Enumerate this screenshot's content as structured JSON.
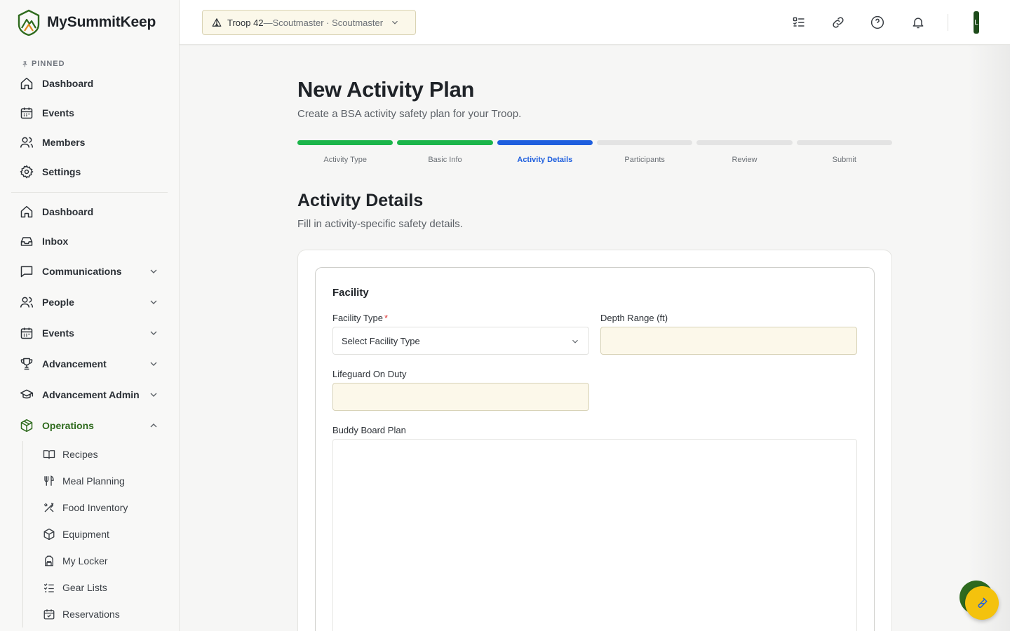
{
  "brand": {
    "name": "MySummitKeep"
  },
  "sidebar": {
    "pinned_label": "PINNED",
    "pinned": [
      {
        "label": "Dashboard",
        "icon": "home-icon"
      },
      {
        "label": "Events",
        "icon": "calendar-icon"
      },
      {
        "label": "Members",
        "icon": "users-icon"
      },
      {
        "label": "Settings",
        "icon": "gear-icon"
      }
    ],
    "main": [
      {
        "label": "Dashboard",
        "icon": "home-icon"
      },
      {
        "label": "Inbox",
        "icon": "inbox-icon"
      },
      {
        "label": "Communications",
        "icon": "message-icon",
        "expandable": true
      },
      {
        "label": "People",
        "icon": "users-icon",
        "expandable": true
      },
      {
        "label": "Events",
        "icon": "calendar-icon",
        "expandable": true
      },
      {
        "label": "Advancement",
        "icon": "trophy-icon",
        "expandable": true
      },
      {
        "label": "Advancement Admin",
        "icon": "graduation-cap-icon",
        "expandable": true
      },
      {
        "label": "Operations",
        "icon": "box-icon",
        "expandable": true,
        "expanded": true,
        "active": true
      }
    ],
    "operations_sub": [
      {
        "label": "Recipes",
        "icon": "book-icon"
      },
      {
        "label": "Meal Planning",
        "icon": "utensils-icon"
      },
      {
        "label": "Food Inventory",
        "icon": "utensils-crossed-icon"
      },
      {
        "label": "Equipment",
        "icon": "package-icon"
      },
      {
        "label": "My Locker",
        "icon": "backpack-icon"
      },
      {
        "label": "Gear Lists",
        "icon": "checklist-icon"
      },
      {
        "label": "Reservations",
        "icon": "calendar-check-icon"
      }
    ]
  },
  "topbar": {
    "troop_name": "Troop 42",
    "troop_separator": " — ",
    "troop_role": "Scoutmaster · Scoutmaster",
    "icons": [
      "checklist-icon",
      "link-icon",
      "help-icon",
      "bell-icon"
    ],
    "avatar_initial": "L"
  },
  "page": {
    "title": "New Activity Plan",
    "subtitle": "Create a BSA activity safety plan for your Troop."
  },
  "steps": {
    "current_index": 2,
    "items": [
      {
        "label": "Activity Type",
        "state": "done"
      },
      {
        "label": "Basic Info",
        "state": "done"
      },
      {
        "label": "Activity Details",
        "state": "current"
      },
      {
        "label": "Participants",
        "state": "todo"
      },
      {
        "label": "Review",
        "state": "todo"
      },
      {
        "label": "Submit",
        "state": "todo"
      }
    ]
  },
  "section": {
    "title": "Activity Details",
    "subtitle": "Fill in activity-specific safety details."
  },
  "form": {
    "fieldset_title": "Facility",
    "facility_type": {
      "label": "Facility Type",
      "required_mark": "*",
      "value": "Select Facility Type"
    },
    "depth_range": {
      "label": "Depth Range (ft)",
      "value": ""
    },
    "lifeguard": {
      "label": "Lifeguard On Duty",
      "value": ""
    },
    "buddy_board": {
      "label": "Buddy Board Plan",
      "value": ""
    }
  },
  "colors": {
    "brand_green": "#2f6b1e",
    "step_done": "#1bb54a",
    "step_current": "#1f5fde",
    "input_fill": "#fcf8ea",
    "fab": "#f4c20d"
  }
}
